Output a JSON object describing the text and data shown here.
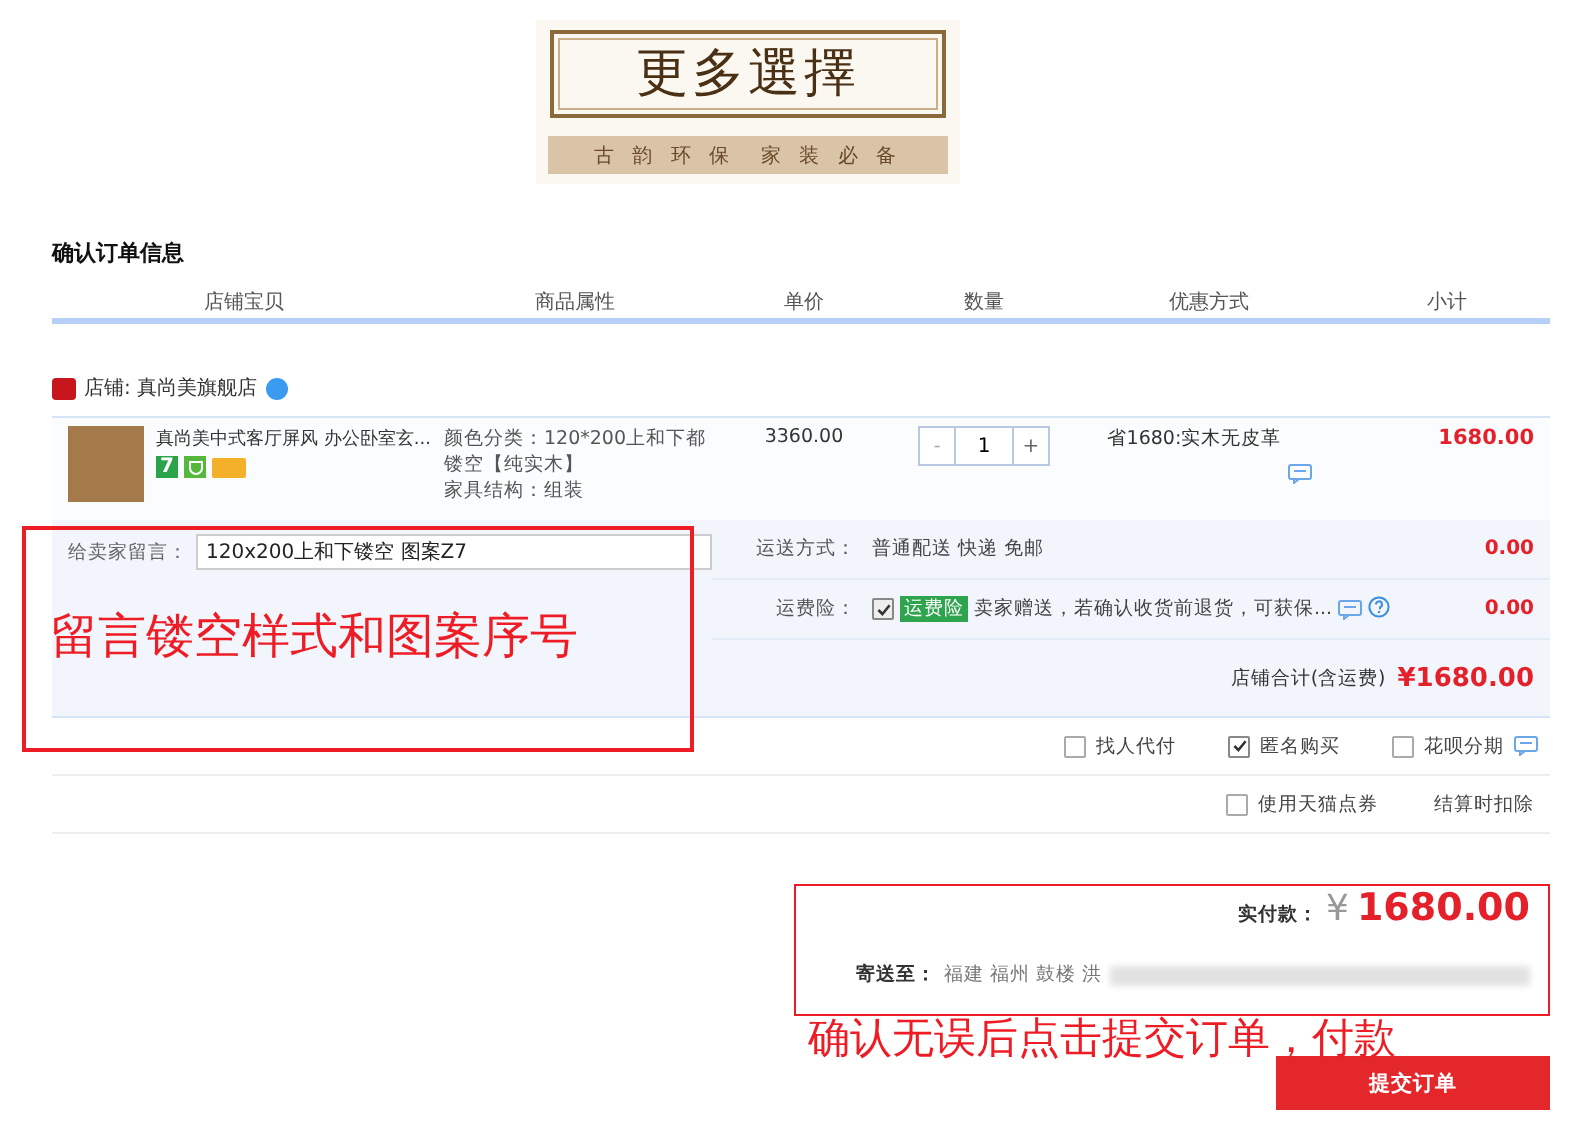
{
  "banner": {
    "title": "更多選擇",
    "subtitle": "古 韵 环 保　家 装 必 备"
  },
  "section_title": "确认订单信息",
  "columns": [
    "店铺宝贝",
    "商品属性",
    "单价",
    "数量",
    "优惠方式",
    "小计"
  ],
  "shop": {
    "label": "店铺: 真尚美旗舰店"
  },
  "item": {
    "name": "真尚美中式客厅屏风 办公卧室玄...",
    "attributes": [
      "颜色分类：120*200上和下都镂空【纯实木】",
      "家具结构：组装"
    ],
    "price": "3360.00",
    "quantity": "1",
    "minus": "-",
    "plus": "+",
    "discount": "省1680:实木无皮革",
    "subtotal": "1680.00",
    "badges": [
      "7"
    ]
  },
  "message": {
    "label": "给卖家留言：",
    "value": "120x200上和下镂空 图案Z7"
  },
  "shipping": {
    "label": "运送方式：",
    "value": "普通配送 快递 免邮",
    "amount": "0.00"
  },
  "insurance": {
    "label": "运费险：",
    "checked": true,
    "tag": "运费险",
    "text": "卖家赠送，若确认收货前退货，可获保...",
    "amount": "0.00"
  },
  "store_total": {
    "label": "店铺合计(含运费)",
    "amount": "¥1680.00"
  },
  "options": [
    {
      "label": "找人代付",
      "checked": false
    },
    {
      "label": "匿名购买",
      "checked": true
    },
    {
      "label": "花呗分期",
      "checked": false
    }
  ],
  "coupon": {
    "label": "使用天猫点券",
    "checked": false,
    "note": "结算时扣除"
  },
  "payment": {
    "label": "实付款：",
    "currency": "¥",
    "amount": "1680.00",
    "address_label": "寄送至：",
    "address": "福建 福州 鼓楼 洪"
  },
  "submit": "提交订单",
  "annotations": [
    "留言镂空样式和图案序号",
    "确认无误后点击提交订单，付款"
  ]
}
